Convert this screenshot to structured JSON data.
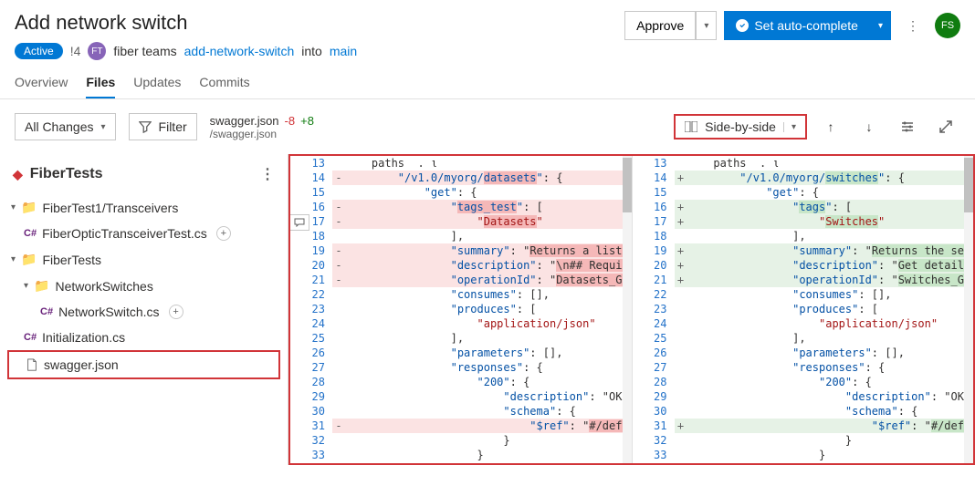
{
  "header": {
    "title": "Add network switch",
    "status": "Active",
    "pr_id": "!4",
    "team_initials": "FT",
    "team_name": "fiber teams",
    "branch": "add-network-switch",
    "into": "into",
    "target": "main",
    "approve": "Approve",
    "set_auto": "Set auto-complete",
    "user_initials": "FS"
  },
  "tabs": {
    "overview": "Overview",
    "files": "Files",
    "updates": "Updates",
    "commits": "Commits"
  },
  "toolbar": {
    "all_changes": "All Changes",
    "filter": "Filter",
    "file_name": "swagger.json",
    "removed": "-8",
    "added": "+8",
    "file_path": "/swagger.json",
    "side_by_side": "Side-by-side"
  },
  "tree": {
    "root": "FiberTests",
    "n1": "FiberTest1/Transceivers",
    "f1": "FiberOpticTransceiverTest.cs",
    "n2": "FiberTests",
    "n3": "NetworkSwitches",
    "f2": "NetworkSwitch.cs",
    "f3": "Initialization.cs",
    "f4": "swagger.json"
  },
  "left": [
    {
      "n": 13,
      "s": "",
      "c": "    paths  . ι",
      "cls": ""
    },
    {
      "n": 14,
      "s": "-",
      "c": "        \"/v1.0/myorg/datasets\": {",
      "cls": "del",
      "hl": "datasets"
    },
    {
      "n": 15,
      "s": "",
      "c": "            \"get\": {",
      "cls": ""
    },
    {
      "n": 16,
      "s": "-",
      "c": "                \"tags_test\": [",
      "cls": "del",
      "hl": "tags_test"
    },
    {
      "n": 17,
      "s": "-",
      "c": "                    \"Datasets\"",
      "cls": "del",
      "hl": "Datasets"
    },
    {
      "n": 18,
      "s": "",
      "c": "                ],",
      "cls": ""
    },
    {
      "n": 19,
      "s": "-",
      "c": "                \"summary\": \"Returns a list of",
      "cls": "del",
      "hl": "Returns a list of"
    },
    {
      "n": 20,
      "s": "-",
      "c": "                \"description\": \"\\n## Required",
      "cls": "del",
      "hl": "\\n## Required"
    },
    {
      "n": 21,
      "s": "-",
      "c": "                \"operationId\": \"Datasets_GetD",
      "cls": "del",
      "hl": "Datasets_GetD"
    },
    {
      "n": 22,
      "s": "",
      "c": "                \"consumes\": [],",
      "cls": ""
    },
    {
      "n": 23,
      "s": "",
      "c": "                \"produces\": [",
      "cls": ""
    },
    {
      "n": 24,
      "s": "",
      "c": "                    \"application/json\"",
      "cls": ""
    },
    {
      "n": 25,
      "s": "",
      "c": "                ],",
      "cls": ""
    },
    {
      "n": 26,
      "s": "",
      "c": "                \"parameters\": [],",
      "cls": ""
    },
    {
      "n": 27,
      "s": "",
      "c": "                \"responses\": {",
      "cls": ""
    },
    {
      "n": 28,
      "s": "",
      "c": "                    \"200\": {",
      "cls": ""
    },
    {
      "n": 29,
      "s": "",
      "c": "                        \"description\": \"OK\",",
      "cls": ""
    },
    {
      "n": 30,
      "s": "",
      "c": "                        \"schema\": {",
      "cls": ""
    },
    {
      "n": 31,
      "s": "-",
      "c": "                            \"$ref\": \"#/definit",
      "cls": "del",
      "hl": "#/definit"
    },
    {
      "n": 32,
      "s": "",
      "c": "                        }",
      "cls": ""
    },
    {
      "n": 33,
      "s": "",
      "c": "                    }",
      "cls": ""
    }
  ],
  "right": [
    {
      "n": 13,
      "s": "",
      "c": "    paths  . ι",
      "cls": ""
    },
    {
      "n": 14,
      "s": "+",
      "c": "        \"/v1.0/myorg/switches\": {",
      "cls": "add",
      "hl": "switches"
    },
    {
      "n": 15,
      "s": "",
      "c": "            \"get\": {",
      "cls": ""
    },
    {
      "n": 16,
      "s": "+",
      "c": "                \"tags\": [",
      "cls": "add",
      "hl": "tags"
    },
    {
      "n": 17,
      "s": "+",
      "c": "                    \"Switches\"",
      "cls": "add",
      "hl": "Switches"
    },
    {
      "n": 18,
      "s": "",
      "c": "                ],",
      "cls": ""
    },
    {
      "n": 19,
      "s": "+",
      "c": "                \"summary\": \"Returns the select",
      "cls": "add",
      "hl": "Returns the select"
    },
    {
      "n": 20,
      "s": "+",
      "c": "                \"description\": \"Get detailed s",
      "cls": "add",
      "hl": "Get detailed s"
    },
    {
      "n": 21,
      "s": "+",
      "c": "                \"operationId\": \"Switches_GetSw",
      "cls": "add",
      "hl": "Switches_GetSw"
    },
    {
      "n": 22,
      "s": "",
      "c": "                \"consumes\": [],",
      "cls": ""
    },
    {
      "n": 23,
      "s": "",
      "c": "                \"produces\": [",
      "cls": ""
    },
    {
      "n": 24,
      "s": "",
      "c": "                    \"application/json\"",
      "cls": ""
    },
    {
      "n": 25,
      "s": "",
      "c": "                ],",
      "cls": ""
    },
    {
      "n": 26,
      "s": "",
      "c": "                \"parameters\": [],",
      "cls": ""
    },
    {
      "n": 27,
      "s": "",
      "c": "                \"responses\": {",
      "cls": ""
    },
    {
      "n": 28,
      "s": "",
      "c": "                    \"200\": {",
      "cls": ""
    },
    {
      "n": 29,
      "s": "",
      "c": "                        \"description\": \"OK\",",
      "cls": ""
    },
    {
      "n": 30,
      "s": "",
      "c": "                        \"schema\": {",
      "cls": ""
    },
    {
      "n": 31,
      "s": "+",
      "c": "                            \"$ref\": \"#/definit",
      "cls": "add",
      "hl": "#/definit"
    },
    {
      "n": 32,
      "s": "",
      "c": "                        }",
      "cls": ""
    },
    {
      "n": 33,
      "s": "",
      "c": "                    }",
      "cls": ""
    }
  ]
}
